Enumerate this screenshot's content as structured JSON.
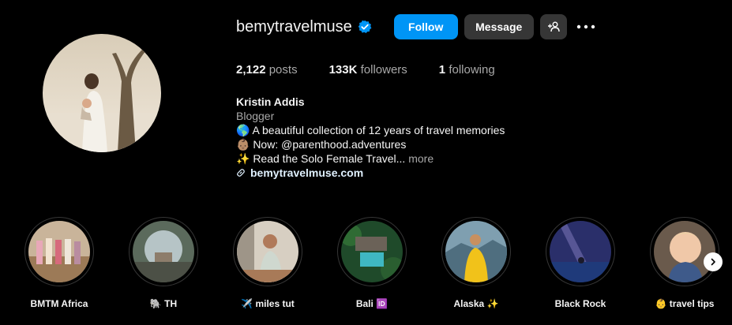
{
  "profile": {
    "username": "bemytravelmuse",
    "follow_label": "Follow",
    "message_label": "Message",
    "stats": {
      "posts_count": "2,122",
      "posts_label": "posts",
      "followers_count": "133K",
      "followers_label": "followers",
      "following_count": "1",
      "following_label": "following"
    },
    "bio": {
      "name": "Kristin Addis",
      "category": "Blogger",
      "line1": "🌎 A beautiful collection of 12 years of travel memories",
      "line2": "👶🏽 Now: @parenthood.adventures",
      "line3": "✨ Read the Solo Female Travel...",
      "more": "more",
      "link": "bemytravelmuse.com"
    }
  },
  "highlights": [
    {
      "label": "BMTM Africa"
    },
    {
      "label": "🐘 TH"
    },
    {
      "label": "✈️ miles tut"
    },
    {
      "label": "Bali 🆔"
    },
    {
      "label": "Alaska ✨"
    },
    {
      "label": "Black Rock"
    },
    {
      "label": "👶 travel tips"
    }
  ],
  "colors": {
    "background": "#000000",
    "follow_button": "#0095f6",
    "secondary_button": "#363636",
    "verified_badge": "#0095f6",
    "link_text": "#e0f1ff"
  },
  "icons": [
    "verified-badge-icon",
    "add-user-icon",
    "more-options-icon",
    "link-icon",
    "chevron-right-icon"
  ]
}
